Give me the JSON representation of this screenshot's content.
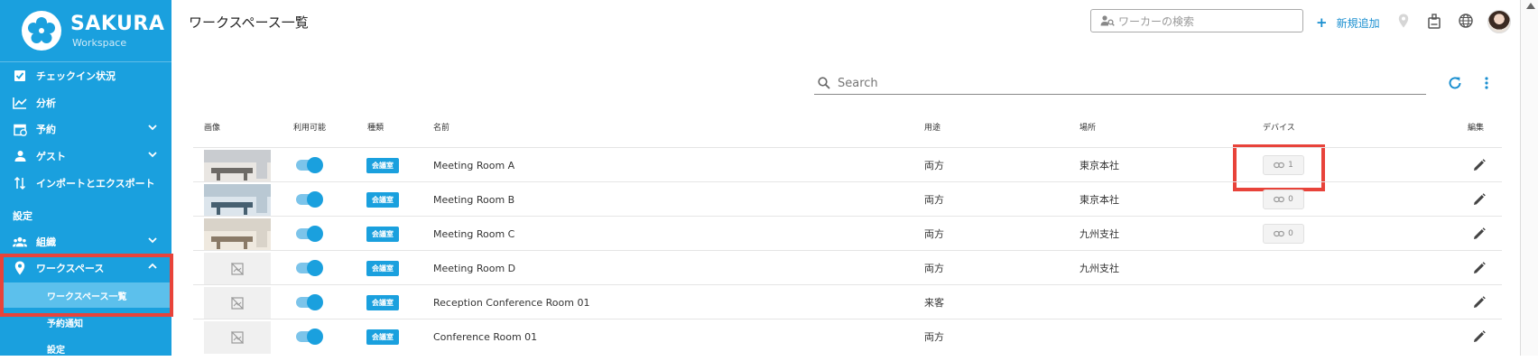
{
  "app": {
    "logo_title": "SAKURA",
    "logo_subtitle": "Workspace",
    "page_title": "ワークスペース一覧"
  },
  "sidebar": {
    "items": [
      {
        "label": "チェックイン状況",
        "icon": "checkbox-icon"
      },
      {
        "label": "分析",
        "icon": "chart-line-icon"
      },
      {
        "label": "予約",
        "icon": "calendar-icon"
      },
      {
        "label": "ゲスト",
        "icon": "guest-icon"
      },
      {
        "label": "インポートとエクスポート",
        "icon": "import-export-icon"
      }
    ],
    "section_label": "設定",
    "org_label": "組織",
    "workspace_label": "ワークスペース",
    "sub_items": [
      "ワークスペース一覧",
      "予約通知",
      "設定"
    ]
  },
  "header": {
    "worker_search_placeholder": "ワーカーの検索",
    "add_new_label": "新規追加"
  },
  "search": {
    "placeholder": "Search"
  },
  "table": {
    "headers": {
      "image": "画像",
      "available": "利用可能",
      "type": "種類",
      "name": "名前",
      "usage": "用途",
      "location": "場所",
      "device": "デバイス",
      "edit": "編集"
    },
    "rows": [
      {
        "has_image": true,
        "type": "会議室",
        "name": "Meeting Room A",
        "usage": "両方",
        "location": "東京本社",
        "devices": "1"
      },
      {
        "has_image": true,
        "type": "会議室",
        "name": "Meeting Room B",
        "usage": "両方",
        "location": "東京本社",
        "devices": "0"
      },
      {
        "has_image": true,
        "type": "会議室",
        "name": "Meeting Room C",
        "usage": "両方",
        "location": "九州支社",
        "devices": "0"
      },
      {
        "has_image": false,
        "type": "会議室",
        "name": "Meeting Room D",
        "usage": "両方",
        "location": "九州支社",
        "devices": ""
      },
      {
        "has_image": false,
        "type": "会議室",
        "name": "Reception Conference Room 01",
        "usage": "来客",
        "location": "",
        "devices": ""
      },
      {
        "has_image": false,
        "type": "会議室",
        "name": "Conference Room 01",
        "usage": "両方",
        "location": "",
        "devices": ""
      }
    ]
  },
  "colors": {
    "brand": "#1aa0de",
    "highlight": "#e8433a"
  }
}
